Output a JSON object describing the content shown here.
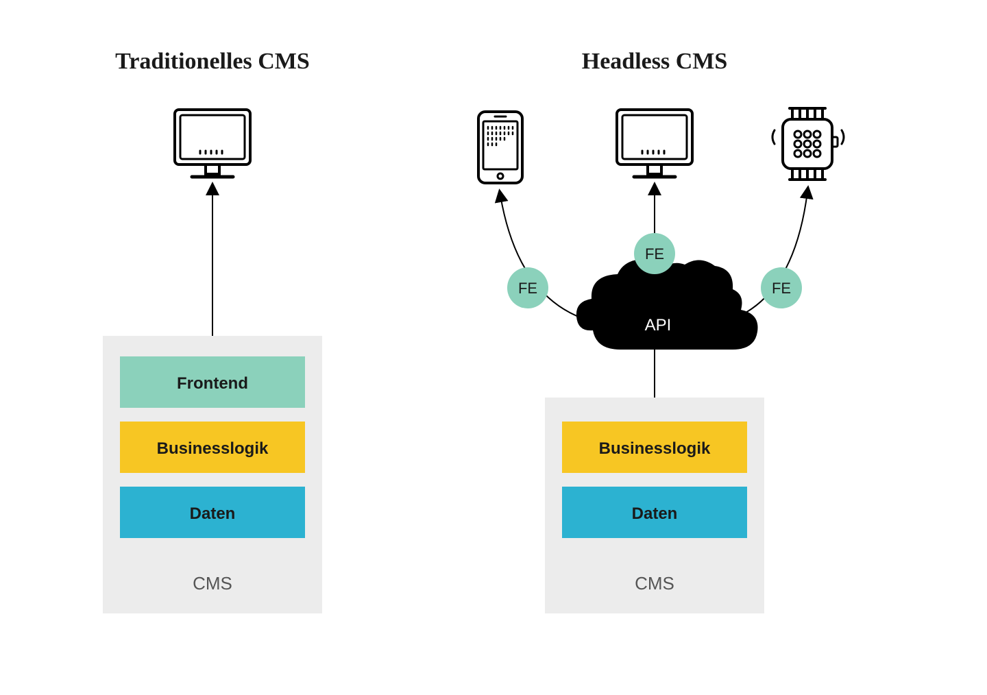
{
  "traditional": {
    "title": "Traditionelles CMS",
    "layers": {
      "frontend": "Frontend",
      "business": "Businesslogik",
      "data": "Daten"
    },
    "box_label": "CMS"
  },
  "headless": {
    "title": "Headless CMS",
    "fe_badge": "FE",
    "api_label": "API",
    "layers": {
      "business": "Businesslogik",
      "data": "Daten"
    },
    "box_label": "CMS"
  },
  "colors": {
    "box_bg": "#ececec",
    "frontend": "#8bd1bb",
    "business": "#f7c623",
    "data": "#2cb2d1",
    "fe_badge": "#8bd1bb",
    "cloud": "#000000",
    "stroke": "#000000"
  }
}
